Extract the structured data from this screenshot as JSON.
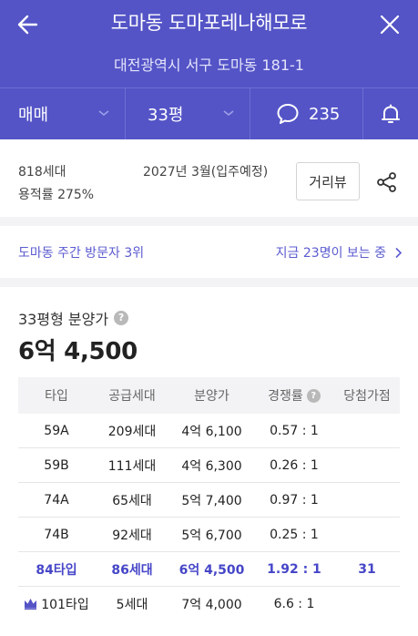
{
  "header": {
    "title": "도마동 도마포레나해모로",
    "address": "대전광역시 서구 도마동 181-1"
  },
  "filters": {
    "deal_type": "매매",
    "size": "33평",
    "talk_count": "235"
  },
  "summary": {
    "households": "818세대",
    "floor_area_ratio": "용적률 275%",
    "move_in": "2027년 3월(입주예정)",
    "distance_view_label": "거리뷰"
  },
  "visitors": {
    "rank_text": "도마동 주간 방문자 3위",
    "now_viewing_text": "지금 23명이 보는 중"
  },
  "price": {
    "label": "33평형 분양가",
    "value": "6억 4,500"
  },
  "table": {
    "headers": [
      "타입",
      "공급세대",
      "분양가",
      "경쟁률",
      "당첨가점"
    ],
    "rows": [
      {
        "type": "59A",
        "supply": "209세대",
        "price": "4억 6,100",
        "competition": "0.57 : 1",
        "score": ""
      },
      {
        "type": "59B",
        "supply": "111세대",
        "price": "4억 6,300",
        "competition": "0.26 : 1",
        "score": ""
      },
      {
        "type": "74A",
        "supply": "65세대",
        "price": "5억 7,400",
        "competition": "0.97 : 1",
        "score": ""
      },
      {
        "type": "74B",
        "supply": "92세대",
        "price": "5억 6,700",
        "competition": "0.25 : 1",
        "score": ""
      },
      {
        "type": "84타입",
        "supply": "86세대",
        "price": "6억 4,500",
        "competition": "1.92 : 1",
        "score": "31"
      },
      {
        "type": "101타입",
        "supply": "5세대",
        "price": "7억 4,000",
        "competition": "6.6 : 1",
        "score": ""
      }
    ]
  },
  "colors": {
    "header_bg": "#5454c7",
    "accent": "#4646c8",
    "separator": "#f3f3f5"
  }
}
